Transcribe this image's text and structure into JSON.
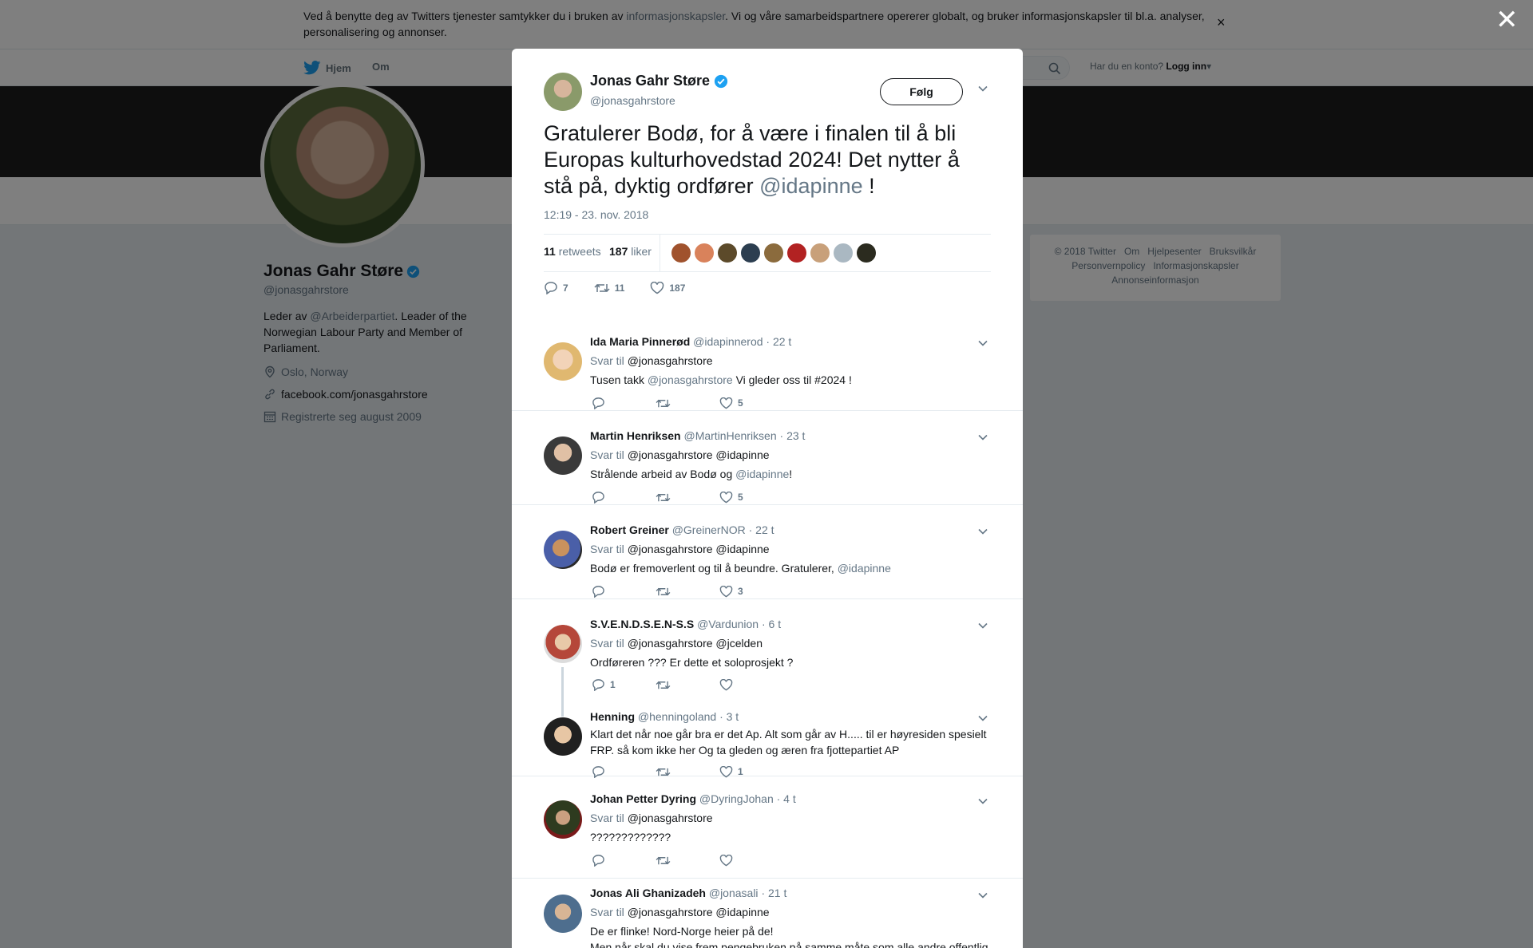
{
  "cookie": {
    "text_before": "Ved å benytte deg av Twitters tjenester samtykker du i bruken av ",
    "link": "informasjonskapsler",
    "text_after": ". Vi og våre samarbeidspartnere opererer globalt, og bruker informasjonskapsler til bl.a. analyser, personalisering og annonser."
  },
  "nav": {
    "home": "Hjem",
    "about": "Om",
    "login_prompt": "Har du en konto?",
    "login": "Logg inn"
  },
  "profile": {
    "name": "Jonas Gahr Støre",
    "handle": "@jonasgahrstore",
    "bio_prefix": "Leder av ",
    "bio_link": "@Arbeiderpartiet",
    "bio_suffix": ". Leader of the Norwegian Labour Party and Member of Parliament.",
    "location": "Oslo, Norway",
    "website": "facebook.com/jonasgahrstore",
    "joined": "Registrerte seg august 2009"
  },
  "footer": {
    "row1": [
      "© 2018 Twitter",
      "Om",
      "Hjelpesenter",
      "Bruksvilkår"
    ],
    "row2": [
      "Personvernpolicy",
      "Informasjonskapsler"
    ],
    "row3": [
      "Annonseinformasjon"
    ]
  },
  "tweet": {
    "name": "Jonas Gahr Støre",
    "handle": "@jonasgahrstore",
    "follow": "Følg",
    "text": "Gratulerer Bodø, for å være i finalen til å bli Europas kulturhovedstad 2024! Det nytter å stå på, dyktig ordfører ",
    "mention": "@idapinne",
    "text_end": " !",
    "time": "12:19 - 23. nov. 2018",
    "retweets": "11",
    "retweets_label": "retweets",
    "likes": "187",
    "likes_label": "liker",
    "reply_count": "7",
    "retweet_count": "11",
    "like_count": "187"
  },
  "replies": [
    {
      "name": "Ida Maria Pinnerød",
      "handle": "@idapinnerod",
      "time": "· 22 t",
      "svar": "Svar til",
      "to": "@jonasgahrstore",
      "text": "Tusen takk ",
      "mention": "@jonasgahrstore",
      "text2": " Vi gleder oss til #2024 !",
      "replies": "",
      "likes": "5"
    },
    {
      "name": "Martin Henriksen",
      "handle": "@MartinHenriksen",
      "time": "· 23 t",
      "svar": "Svar til",
      "to": "@jonasgahrstore @idapinne",
      "text": "Strålende arbeid av Bodø og ",
      "mention": "@idapinne",
      "text2": "!",
      "replies": "",
      "likes": "5"
    },
    {
      "name": "Robert Greiner",
      "handle": "@GreinerNOR",
      "time": "· 22 t",
      "svar": "Svar til",
      "to": "@jonasgahrstore @idapinne",
      "text": "Bodø er fremoverlent og til å beundre. Gratulerer, ",
      "mention": "@idapinne",
      "text2": "",
      "replies": "",
      "likes": "3"
    },
    {
      "name": "S.V.E.N.D.S.E.N-S.S",
      "handle": "@Vardunion",
      "time": "· 6 t",
      "svar": "Svar til",
      "to": "@jonasgahrstore @jcelden",
      "text": "Ordføreren ??? Er dette et soloprosjekt ?",
      "mention": "",
      "text2": "",
      "replies": "1",
      "likes": ""
    },
    {
      "name": "Henning",
      "handle": "@henningoland",
      "time": "· 3 t",
      "svar": "",
      "to": "",
      "text": "Klart det når noe går bra er det Ap. Alt som går av H..... til er høyresiden spesielt FRP. så kom ikke her Og ta gleden og æren fra fjottepartiet AP",
      "mention": "",
      "text2": "",
      "replies": "",
      "likes": "1"
    },
    {
      "name": "Johan Petter Dyring",
      "handle": "@DyringJohan",
      "time": "· 4 t",
      "svar": "Svar til",
      "to": "@jonasgahrstore",
      "text": "?????????????",
      "mention": "",
      "text2": "",
      "replies": "",
      "likes": ""
    },
    {
      "name": "Jonas Ali Ghanizadeh",
      "handle": "@jonasali",
      "time": "· 21 t",
      "svar": "Svar til",
      "to": "@jonasgahrstore @idapinne",
      "text": "De er flinke! Nord-Norge heier på de!",
      "text_line2": "Men når skal du vise frem pengebruken på samme måte som alle andre offentlig",
      "mention": "",
      "text2": "",
      "replies": "",
      "likes": ""
    }
  ],
  "colors": {
    "accent": "#1da1f2",
    "text": "#14171a",
    "muted": "#657786",
    "verified": "#1da1f2",
    "heart": "#657786"
  }
}
